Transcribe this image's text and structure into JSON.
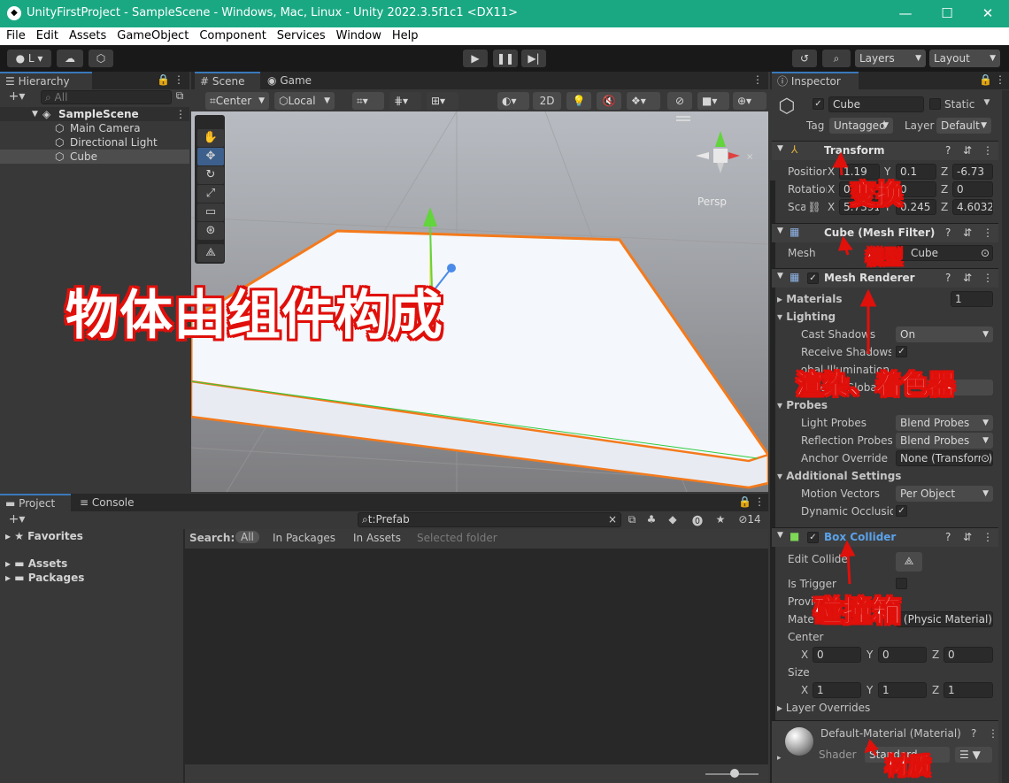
{
  "window": {
    "title": "UnityFirstProject - SampleScene - Windows, Mac, Linux - Unity 2022.3.5f1c1 <DX11>",
    "minimize": "—",
    "maximize": "☐",
    "close": "✕"
  },
  "menu": [
    "File",
    "Edit",
    "Assets",
    "GameObject",
    "Component",
    "Services",
    "Window",
    "Help"
  ],
  "toolbar": {
    "account_label": "L",
    "layers_label": "Layers",
    "layout_label": "Layout"
  },
  "hierarchy": {
    "tab": "Hierarchy",
    "search_placeholder": "All",
    "scene": "SampleScene",
    "items": [
      "Main Camera",
      "Directional Light",
      "Cube"
    ]
  },
  "scene_view": {
    "tabs": [
      "Scene",
      "Game"
    ],
    "pivot": "Center",
    "space": "Local",
    "mode_2d": "2D",
    "persp": "Persp"
  },
  "project": {
    "tabs": [
      "Project",
      "Console"
    ],
    "search_value": "t:Prefab",
    "badge_count": "14",
    "search_label": "Search:",
    "filters": [
      "All",
      "In Packages",
      "In Assets",
      "Selected folder"
    ],
    "tree": [
      "Favorites",
      "Assets",
      "Packages"
    ]
  },
  "inspector": {
    "tab": "Inspector",
    "object_name": "Cube",
    "static_label": "Static",
    "tag_label": "Tag",
    "tag_value": "Untagged",
    "layer_label": "Layer",
    "layer_value": "Default",
    "transform": {
      "name": "Transform",
      "position_label": "Position",
      "rotation_label": "Rotation",
      "scale_label": "Scale",
      "pos": {
        "x": "1.19",
        "y": "0.1",
        "z": "-6.73"
      },
      "rot": {
        "x": "0",
        "y": "0",
        "z": "0"
      },
      "scale": {
        "x": "5.7391",
        "y": "0.245",
        "z": "4.6032"
      }
    },
    "mesh_filter": {
      "name": "Cube (Mesh Filter)",
      "mesh_label": "Mesh",
      "mesh_value": "Cube"
    },
    "mesh_renderer": {
      "name": "Mesh Renderer",
      "materials_label": "Materials",
      "materials_count": "1",
      "lighting_label": "Lighting",
      "cast_shadows_label": "Cast Shadows",
      "cast_shadows_value": "On",
      "receive_shadows_label": "Receive Shadows",
      "contribute_gi_label": "Contribute Global Illumination",
      "receive_gi_label": "Receive Global Illumination",
      "probes_label": "Probes",
      "light_probes_label": "Light Probes",
      "light_probes_value": "Blend Probes",
      "reflection_probes_label": "Reflection Probes",
      "reflection_probes_value": "Blend Probes",
      "anchor_override_label": "Anchor Override",
      "anchor_override_value": "None (Transform)",
      "additional_label": "Additional Settings",
      "motion_vectors_label": "Motion Vectors",
      "motion_vectors_value": "Per Object Motion",
      "dynamic_occlusion_label": "Dynamic Occlusion"
    },
    "box_collider": {
      "name": "Box Collider",
      "edit_collider_label": "Edit Collider",
      "is_trigger_label": "Is Trigger",
      "provides_contacts_label": "Provides Contacts",
      "material_label": "Material",
      "material_value": "None (Physic Material)",
      "center_label": "Center",
      "center": {
        "x": "0",
        "y": "0",
        "z": "0"
      },
      "size_label": "Size",
      "size": {
        "x": "1",
        "y": "1",
        "z": "1"
      },
      "layer_overrides_label": "Layer Overrides"
    },
    "material": {
      "name": "Default-Material (Material)",
      "shader_label": "Shader",
      "shader_value": "Standard"
    }
  },
  "annotations": {
    "big": "物体由组件构成",
    "transform": "变换",
    "model": "模型",
    "renderer": "渲染、着色器",
    "collider": "碰撞箱",
    "material": "材质"
  },
  "colors": {
    "title_bar": "#1aa883",
    "selection_outline": "#f47a1c",
    "annotation": "#e0100b",
    "accent_blue": "#3a79bb"
  }
}
